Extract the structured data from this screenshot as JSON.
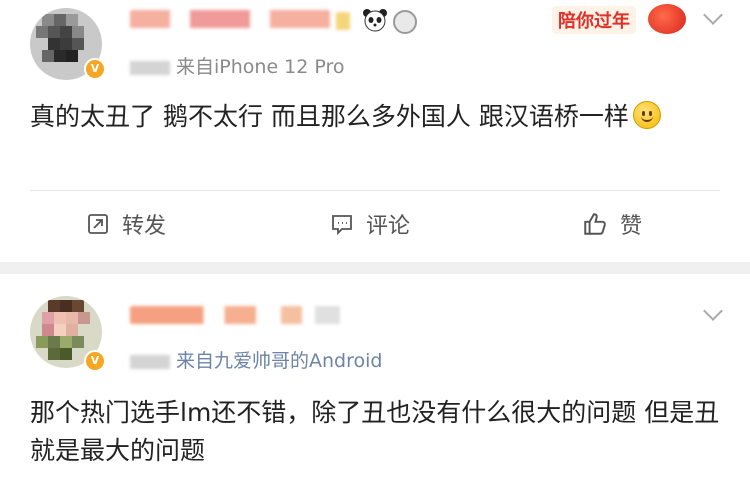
{
  "posts": [
    {
      "source": "来自iPhone 12 Pro",
      "content": "真的太丑了 鹅不太行 而且那么多外国人 跟汉语桥一样",
      "actions": {
        "repost": "转发",
        "comment": "评论",
        "like": "赞"
      },
      "festival_badge": "陪你过年"
    },
    {
      "source": "来自九爱帅哥的Android",
      "content": "那个热门选手lm还不错，除了丑也没有什么很大的问题 但是丑就是最大的问题"
    }
  ],
  "icons": {
    "verified_badge": "verified-icon",
    "emoji": "smiley-icon",
    "menu": "chevron-down-icon",
    "repost": "repost-icon",
    "comment": "comment-icon",
    "like": "thumbs-up-icon",
    "decoration_1": "panda-icon",
    "decoration_2": "medal-icon",
    "decoration_3": "lantern-icon"
  },
  "colors": {
    "verified": "#f5a623",
    "festival_text": "#e0302a",
    "source_text": "#8a8a8a"
  }
}
